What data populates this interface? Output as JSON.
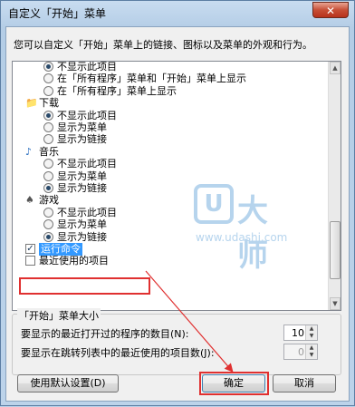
{
  "window": {
    "title": "自定义「开始」菜单",
    "close_glyph": "✕"
  },
  "description": "您可以自定义「开始」菜单上的链接、图标以及菜单的外观和行为。",
  "list": {
    "top_options": [
      "不显示此项目",
      "在「所有程序」菜单和「开始」菜单上显示",
      "在「所有程序」菜单上显示"
    ],
    "top_selected": 0,
    "categories": [
      {
        "name": "下载",
        "icon": "folder-download-icon",
        "options": [
          "不显示此项目",
          "显示为菜单",
          "显示为链接"
        ],
        "selected": 0
      },
      {
        "name": "音乐",
        "icon": "music-note-icon",
        "options": [
          "不显示此项目",
          "显示为菜单",
          "显示为链接"
        ],
        "selected": 2
      },
      {
        "name": "游戏",
        "icon": "game-controller-icon",
        "options": [
          "不显示此项目",
          "显示为菜单",
          "显示为链接"
        ],
        "selected": 2
      }
    ],
    "checkboxes": [
      {
        "label": "运行命令",
        "checked": true,
        "highlighted": true
      },
      {
        "label": "最近使用的项目",
        "checked": false,
        "highlighted": false
      }
    ]
  },
  "watermark": {
    "logo": "U",
    "brand": "大师",
    "url": "www.udashi.com"
  },
  "menu_size": {
    "title": "「开始」菜单大小",
    "recent_programs_label": "要显示的最近打开过的程序的数目(N):",
    "recent_programs_value": "10",
    "jumplist_label": "要显示在跳转列表中的最近使用的项目数(J):",
    "jumplist_value": "0"
  },
  "buttons": {
    "defaults": "使用默认设置(D)",
    "ok": "确定",
    "cancel": "取消"
  },
  "colors": {
    "annotation": "#e03030",
    "selection": "#3399ff"
  }
}
